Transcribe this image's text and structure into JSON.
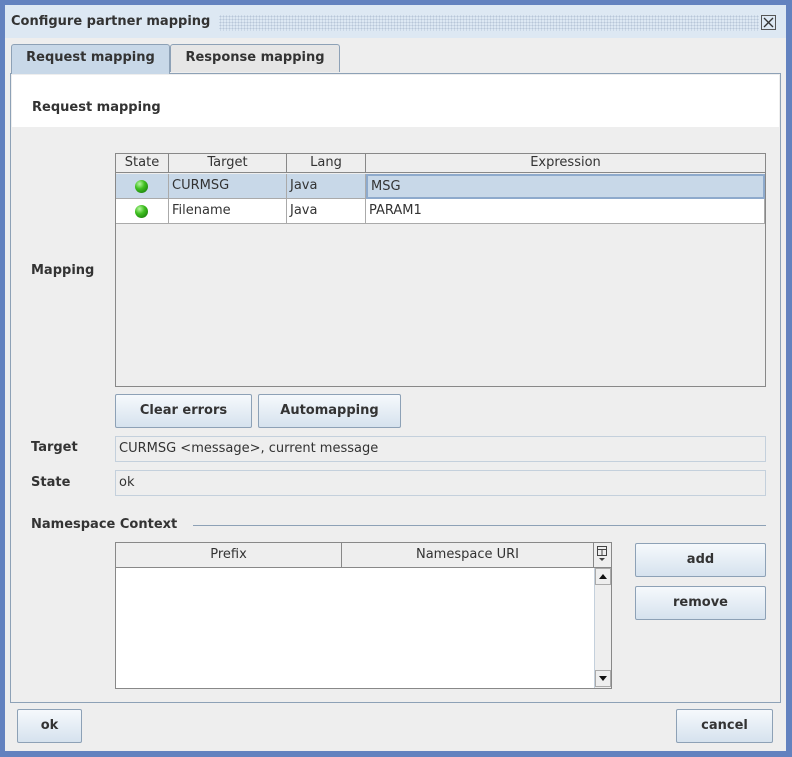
{
  "window": {
    "title": "Configure partner mapping",
    "close_icon": "close-box-icon"
  },
  "tabs": [
    {
      "label": "Request mapping",
      "active": true
    },
    {
      "label": "Response mapping",
      "active": false
    }
  ],
  "section_title": "Request mapping",
  "mapping": {
    "label": "Mapping",
    "columns": [
      "State",
      "Target",
      "Lang",
      "Expression"
    ],
    "rows": [
      {
        "state": "green-ok-icon",
        "target": "CURMSG",
        "lang": "Java",
        "expression": "MSG",
        "selected": true
      },
      {
        "state": "green-ok-icon",
        "target": "Filename",
        "lang": "Java",
        "expression": "PARAM1",
        "selected": false
      }
    ]
  },
  "buttons": {
    "clear_errors": "Clear errors",
    "automapping": "Automapping",
    "add": "add",
    "remove": "remove",
    "ok": "ok",
    "cancel": "cancel"
  },
  "target": {
    "label": "Target",
    "value": "CURMSG <message>, current message"
  },
  "state": {
    "label": "State",
    "value": "ok"
  },
  "namespace": {
    "title": "Namespace Context",
    "columns": [
      "Prefix",
      "Namespace URI"
    ],
    "rows": []
  },
  "colors": {
    "frame": "#6382bf",
    "titlebar": "#dde8f3",
    "selection": "#c8d8e8",
    "status_ok": "#3fbf20"
  }
}
